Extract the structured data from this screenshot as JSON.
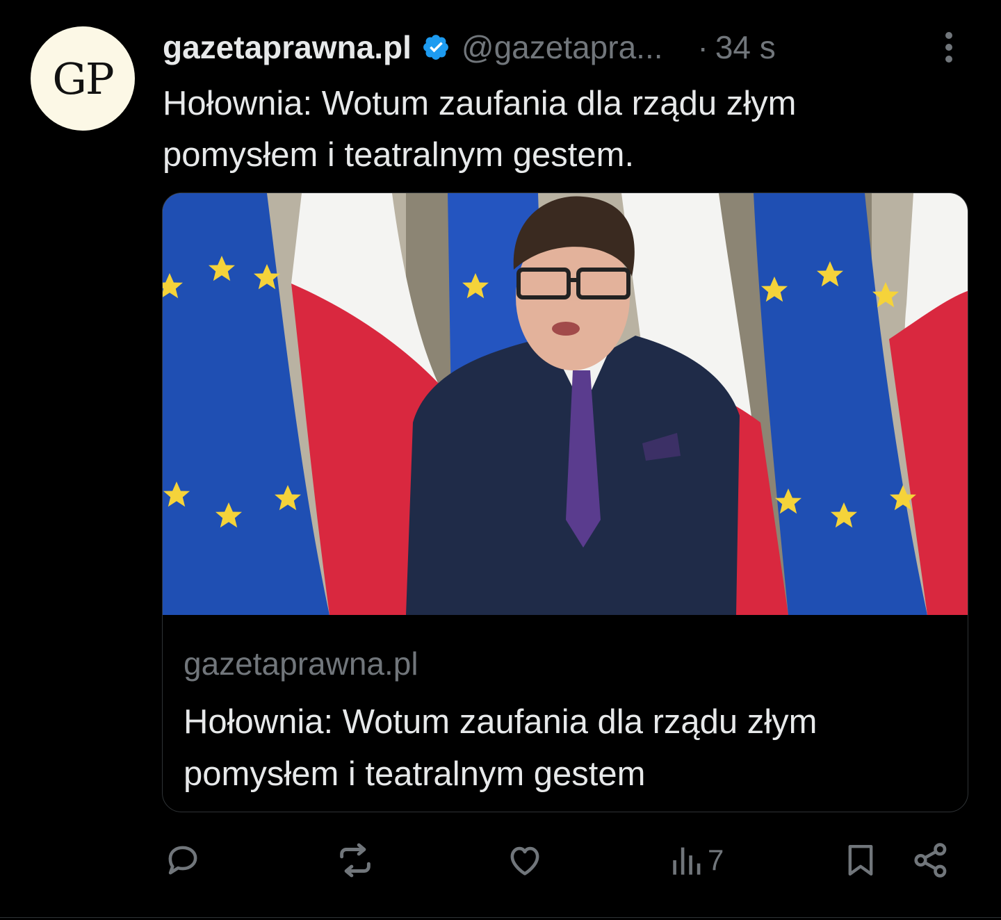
{
  "avatar": {
    "initials": "GP"
  },
  "author": {
    "name": "gazetaprawna.pl",
    "handle": "@gazetapra...",
    "separator": "·",
    "time": "34 s"
  },
  "tweet": {
    "text": "Hołownia: Wotum zaufania dla rządu złym pomysłem i teatralnym gestem."
  },
  "card": {
    "domain": "gazetaprawna.pl",
    "title": "Hołownia: Wotum zaufania dla rządu złym pomysłem i teatralnym gestem"
  },
  "actions": {
    "views": "7"
  },
  "colors": {
    "background": "#000000",
    "text": "#e7e9ea",
    "muted": "#71767b",
    "verified": "#1d9bf0",
    "eu_blue": "#1f4fb3",
    "pl_red": "#dc143c"
  },
  "icons": [
    "verified-badge-icon",
    "more-icon",
    "reply-icon",
    "repost-icon",
    "like-icon",
    "views-icon",
    "bookmark-icon",
    "share-icon"
  ]
}
